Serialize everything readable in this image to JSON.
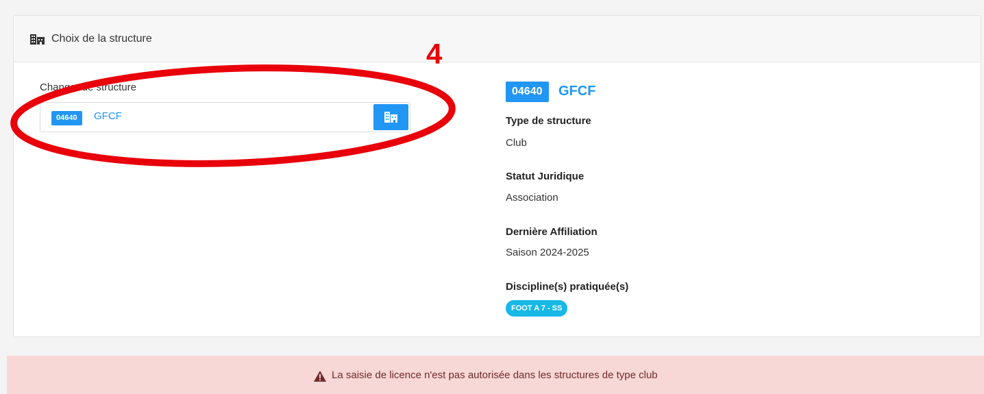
{
  "card": {
    "header_title": "Choix de la structure",
    "header_icon": "building-icon"
  },
  "annotation": {
    "number": "4",
    "color": "#e8000a"
  },
  "selector": {
    "label": "Changer de structure",
    "code": "04640",
    "name": "GFCF",
    "button_icon": "building-icon"
  },
  "info": {
    "code": "04640",
    "name": "GFCF",
    "fields": [
      {
        "label": "Type de structure",
        "value": "Club"
      },
      {
        "label": "Statut Juridique",
        "value": "Association"
      },
      {
        "label": "Dernière Affiliation",
        "value": "Saison 2024-2025"
      },
      {
        "label": "Discipline(s) pratiquée(s)"
      }
    ],
    "discipline": "FOOT A 7 - SS"
  },
  "alert": {
    "icon": "warning-icon",
    "text": "La saisie de licence n'est pas autorisée dans les structures de type club"
  },
  "colors": {
    "primary": "#2196f3",
    "discipline_pill": "#17b8e6",
    "alert_bg": "#f8d7d7",
    "alert_text": "#6f2b2b"
  }
}
